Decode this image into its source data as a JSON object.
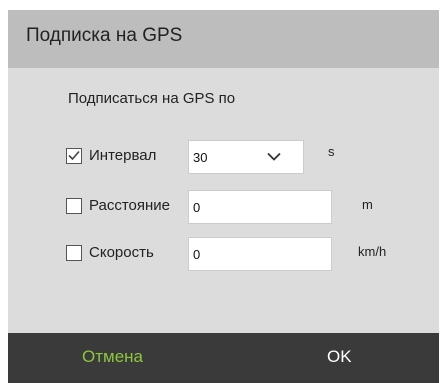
{
  "dialog": {
    "title": "Подписка на GPS",
    "subtitle": "Подписаться на GPS по"
  },
  "rows": {
    "interval": {
      "checked": true,
      "label": "Интервал",
      "value": "30",
      "unit": "s",
      "icon": "chevron-down-icon"
    },
    "distance": {
      "checked": false,
      "label": "Расстояние",
      "value": "0",
      "unit": "m"
    },
    "speed": {
      "checked": false,
      "label": "Скорость",
      "value": "0",
      "unit": "km/h"
    }
  },
  "footer": {
    "cancel_label": "Отмена",
    "ok_label": "OK"
  },
  "colors": {
    "cancel": "#8ec63f",
    "ok": "#ffffff",
    "header": "#bdbdbd",
    "body": "#dcdcdc",
    "footer": "#3a3a3a"
  }
}
